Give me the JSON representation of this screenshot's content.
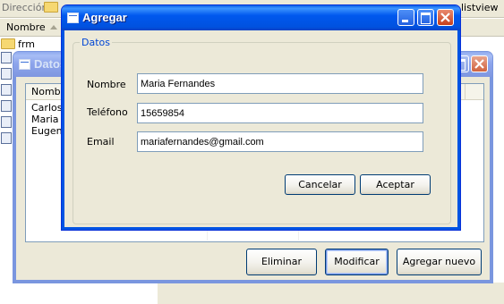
{
  "explorer": {
    "address_label": "Dirección",
    "address_tail": "listview",
    "column_name": "Nombre",
    "folder_row": "frm"
  },
  "datos_window": {
    "title": "Datos",
    "list_header": "Nombre",
    "rows": [
      "Carlos F",
      "Maria F",
      "Eugenia"
    ],
    "buttons": {
      "eliminar": "Eliminar",
      "modificar": "Modificar",
      "agregar_nuevo": "Agregar nuevo"
    }
  },
  "agregar_dialog": {
    "title": "Agregar",
    "group_label": "Datos",
    "fields": {
      "nombre": {
        "label": "Nombre",
        "value": "Maria Fernandes"
      },
      "telefono": {
        "label": "Teléfono",
        "value": "15659854"
      },
      "email": {
        "label": "Email",
        "value": "mariafernandes@gmail.com"
      }
    },
    "buttons": {
      "cancelar": "Cancelar",
      "aceptar": "Aceptar"
    }
  },
  "colors": {
    "xp_blue": "#0054e3",
    "window_face": "#ece9d8",
    "group_label": "#0046d5"
  }
}
